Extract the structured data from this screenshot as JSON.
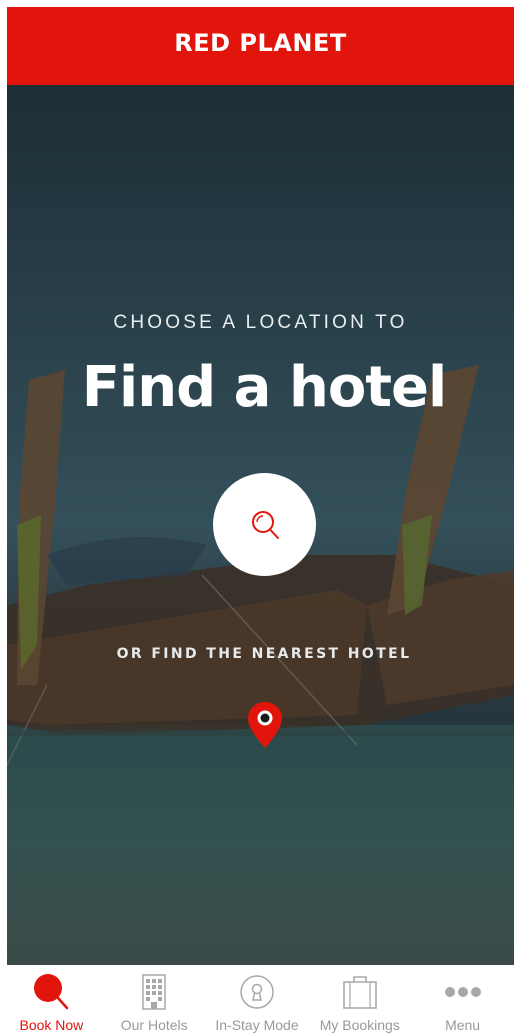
{
  "header": {
    "brand": "RED PLANET"
  },
  "hero": {
    "subtitle": "CHOOSE A LOCATION TO",
    "title": "Find a hotel",
    "search_icon": "search-icon",
    "nearest_text": "OR FIND THE NEAREST HOTEL",
    "location_icon": "map-pin-icon"
  },
  "tabbar": {
    "items": [
      {
        "label": "Book Now",
        "icon": "search-icon",
        "active": true
      },
      {
        "label": "Our Hotels",
        "icon": "building-icon",
        "active": false
      },
      {
        "label": "In-Stay Mode",
        "icon": "keyhole-icon",
        "active": false
      },
      {
        "label": "My Bookings",
        "icon": "suitcase-icon",
        "active": false
      },
      {
        "label": "Menu",
        "icon": "more-dots-icon",
        "active": false
      }
    ]
  },
  "colors": {
    "brand_red": "#e2150c",
    "inactive_gray": "#9a9a9a",
    "hero_overlay": "#23333b"
  }
}
